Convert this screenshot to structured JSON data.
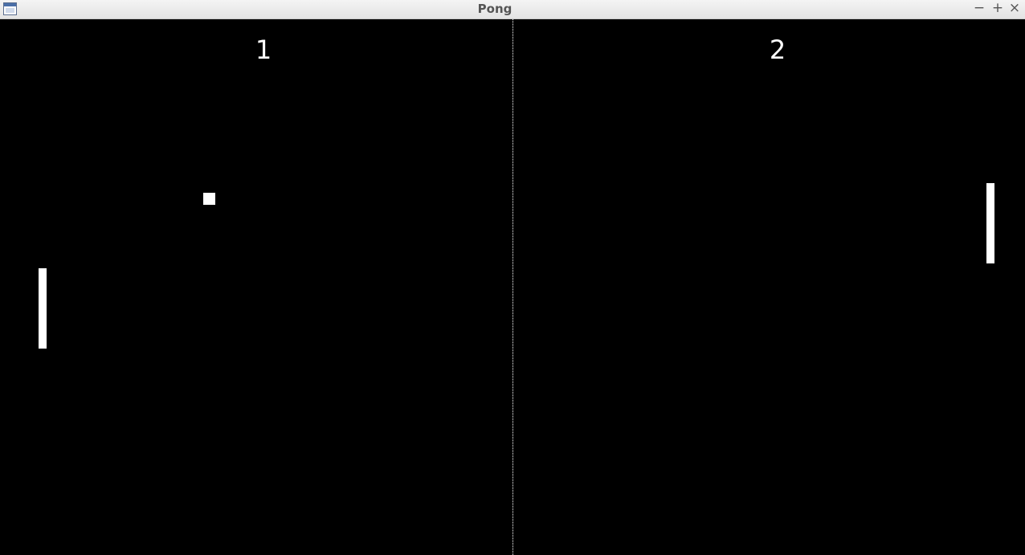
{
  "window": {
    "title": "Pong",
    "icon": "app-window-icon",
    "controls": {
      "minimize": "−",
      "maximize": "+",
      "close": "×"
    }
  },
  "game": {
    "score_left": "1",
    "score_right": "2",
    "colors": {
      "background": "#000000",
      "foreground": "#ffffff"
    }
  }
}
